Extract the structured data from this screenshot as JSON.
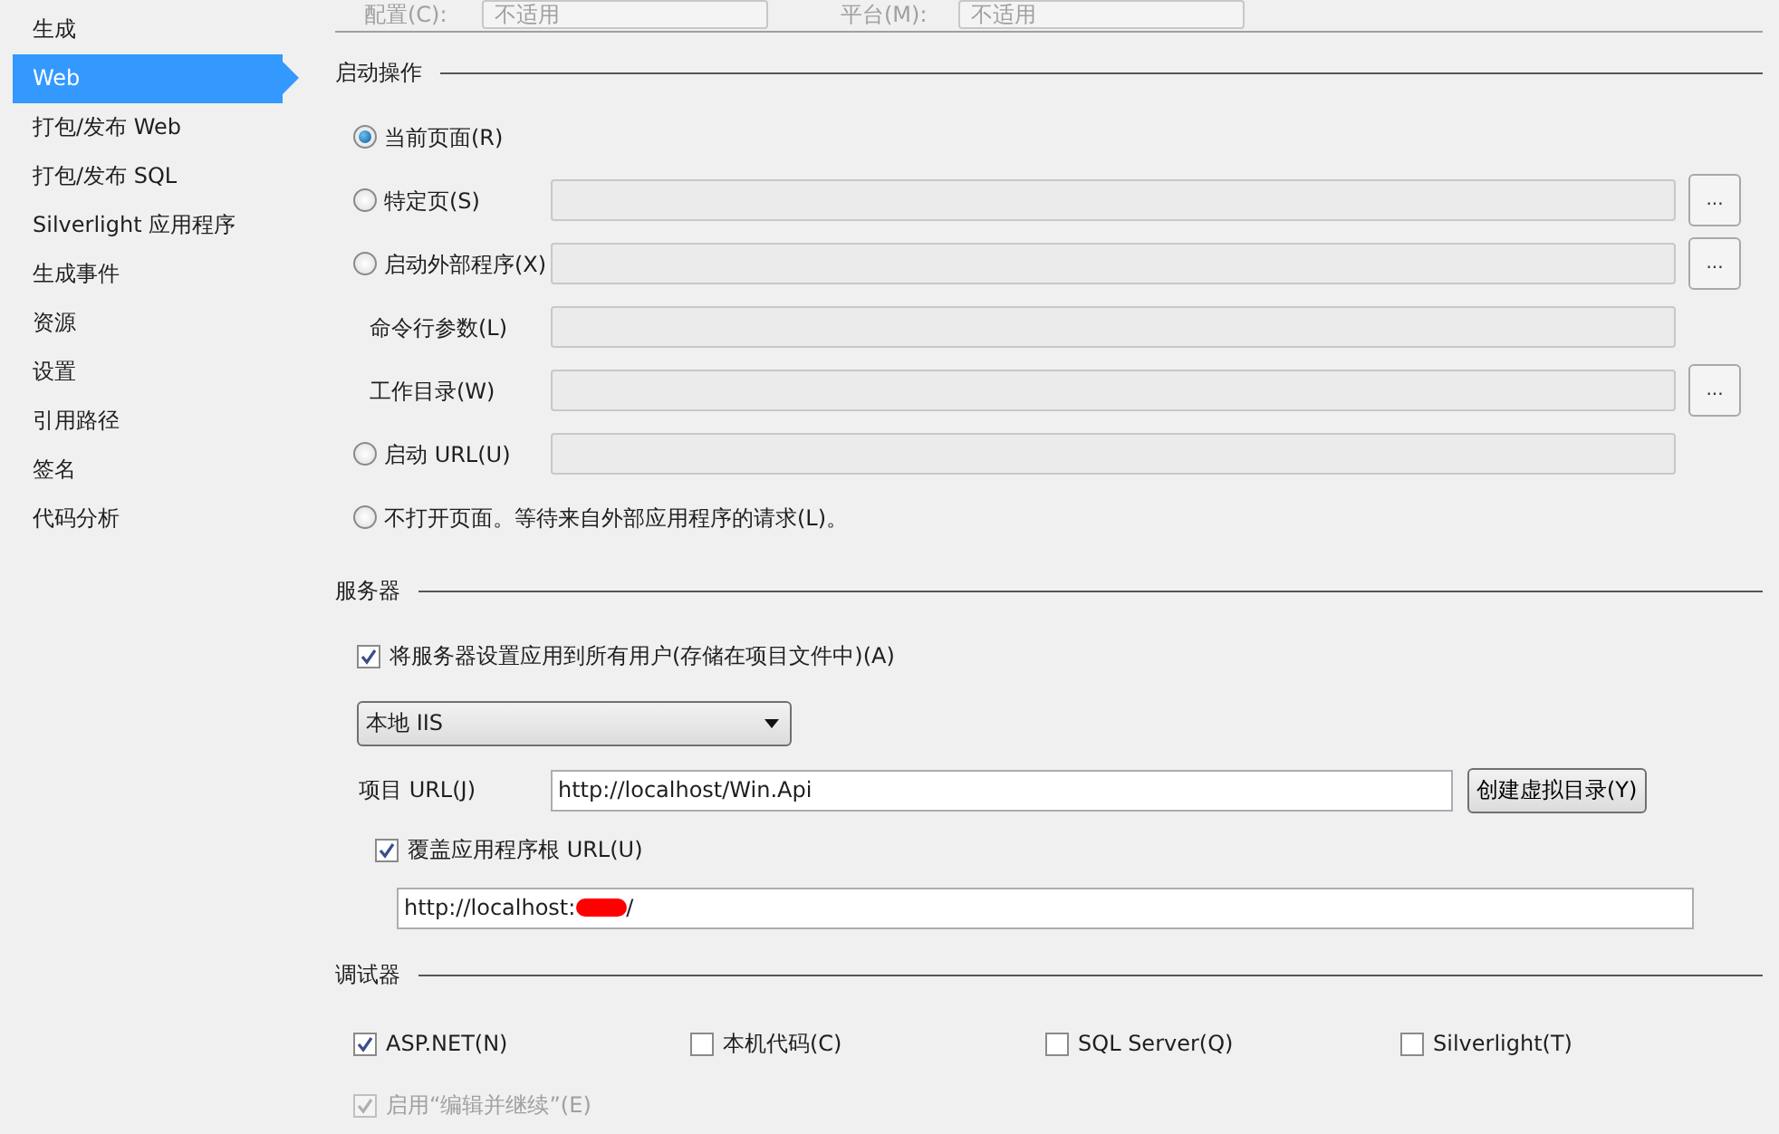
{
  "top_bar": [
    {
      "label": "配置(C):",
      "value": "不适用"
    },
    {
      "label": "平台(M):",
      "value": "不适用"
    }
  ],
  "sidebar": {
    "items": [
      {
        "label": "生成",
        "selected": false
      },
      {
        "label": "Web",
        "selected": true
      },
      {
        "label": "打包/发布 Web",
        "selected": false
      },
      {
        "label": "打包/发布 SQL",
        "selected": false
      },
      {
        "label": "Silverlight 应用程序",
        "selected": false
      },
      {
        "label": "生成事件",
        "selected": false
      },
      {
        "label": "资源",
        "selected": false
      },
      {
        "label": "设置",
        "selected": false
      },
      {
        "label": "引用路径",
        "selected": false
      },
      {
        "label": "签名",
        "selected": false
      },
      {
        "label": "代码分析",
        "selected": false
      }
    ]
  },
  "start_action": {
    "title": "启动操作",
    "rows": [
      {
        "kind": "radio",
        "label": "当前页面(R)",
        "selected": true
      },
      {
        "kind": "radio",
        "label": "特定页(S)",
        "selected": false,
        "has_field": true,
        "browse": "..."
      },
      {
        "kind": "radio",
        "label": "启动外部程序(X)",
        "selected": false,
        "has_field": true,
        "browse": "..."
      },
      {
        "kind": "param",
        "label": "命令行参数(L)",
        "has_field": true
      },
      {
        "kind": "param",
        "label": "工作目录(W)",
        "has_field": true,
        "browse": "..."
      },
      {
        "kind": "radio",
        "label": "启动 URL(U)",
        "selected": false,
        "has_field": true
      },
      {
        "kind": "radio",
        "label": "不打开页面。等待来自外部应用程序的请求(L)。",
        "selected": false
      }
    ]
  },
  "server": {
    "title": "服务器",
    "apply_all": {
      "label": "将服务器设置应用到所有用户(存储在项目文件中)(A)",
      "checked": true
    },
    "server_select": {
      "value": "本地 IIS"
    },
    "project_url": {
      "label": "项目 URL(J)",
      "value": "http://localhost/Win.Api"
    },
    "create_vdir_button": "创建虚拟目录(Y)",
    "override": {
      "label": "覆盖应用程序根 URL(U)",
      "checked": true
    },
    "override_url": {
      "value_before": "http://localhost:",
      "redacted": true,
      "value_after": "/"
    }
  },
  "debugger": {
    "title": "调试器",
    "options": [
      {
        "label": "ASP.NET(N)",
        "checked": true
      },
      {
        "label": "本机代码(C)",
        "checked": false
      },
      {
        "label": "SQL Server(Q)",
        "checked": false
      },
      {
        "label": "Silverlight(T)",
        "checked": false
      }
    ],
    "edit_continue": {
      "label": "启用“编辑并继续”(E)",
      "checked": true,
      "disabled": true
    }
  }
}
